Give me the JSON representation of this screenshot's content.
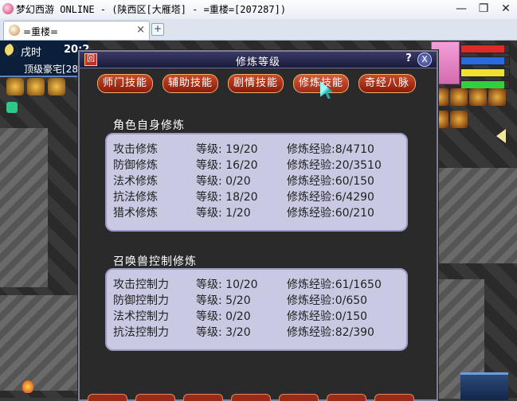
{
  "window": {
    "title": "梦幻西游 ONLINE - (陕西区[大雁塔] - =重楼=[207287])",
    "minimize": "—",
    "restore": "❐",
    "close": "✕"
  },
  "browser_tab": {
    "label": "=重楼=",
    "close": "×",
    "new_tab": "+"
  },
  "hud": {
    "time_period": "戌时",
    "time_value": "20:2",
    "location": "顶级豪宅[28"
  },
  "panel": {
    "title": "修炼等级",
    "help": "?",
    "close": "X",
    "tabs": [
      {
        "label": "师门技能"
      },
      {
        "label": "辅助技能"
      },
      {
        "label": "剧情技能"
      },
      {
        "label": "修炼技能"
      },
      {
        "label": "奇经八脉"
      }
    ],
    "self_section": {
      "title": "角色自身修炼",
      "rows": [
        {
          "name": "攻击修炼",
          "level": "等级: 19/20",
          "exp": "修炼经验:8/4710"
        },
        {
          "name": "防御修炼",
          "level": "等级: 16/20",
          "exp": "修炼经验:20/3510"
        },
        {
          "name": "法术修炼",
          "level": "等级:  0/20",
          "exp": "修炼经验:60/150"
        },
        {
          "name": "抗法修炼",
          "level": "等级: 18/20",
          "exp": "修炼经验:6/4290"
        },
        {
          "name": "猎术修炼",
          "level": "等级:  1/20",
          "exp": "修炼经验:60/210"
        }
      ]
    },
    "pet_section": {
      "title": "召唤兽控制修炼",
      "rows": [
        {
          "name": "攻击控制力",
          "level": "等级: 10/20",
          "exp": "修炼经验:61/1650"
        },
        {
          "name": "防御控制力",
          "level": "等级:  5/20",
          "exp": "修炼经验:0/650"
        },
        {
          "name": "法术控制力",
          "level": "等级:  0/20",
          "exp": "修炼经验:0/150"
        },
        {
          "name": "抗法控制力",
          "level": "等级:  3/20",
          "exp": "修炼经验:82/390"
        }
      ]
    }
  },
  "colors": {
    "panel_bg": "#2a2a2a",
    "box_bg": "#c9c9e4",
    "tab_red": "#b83a1a",
    "header_blue": "#2a2a55"
  }
}
